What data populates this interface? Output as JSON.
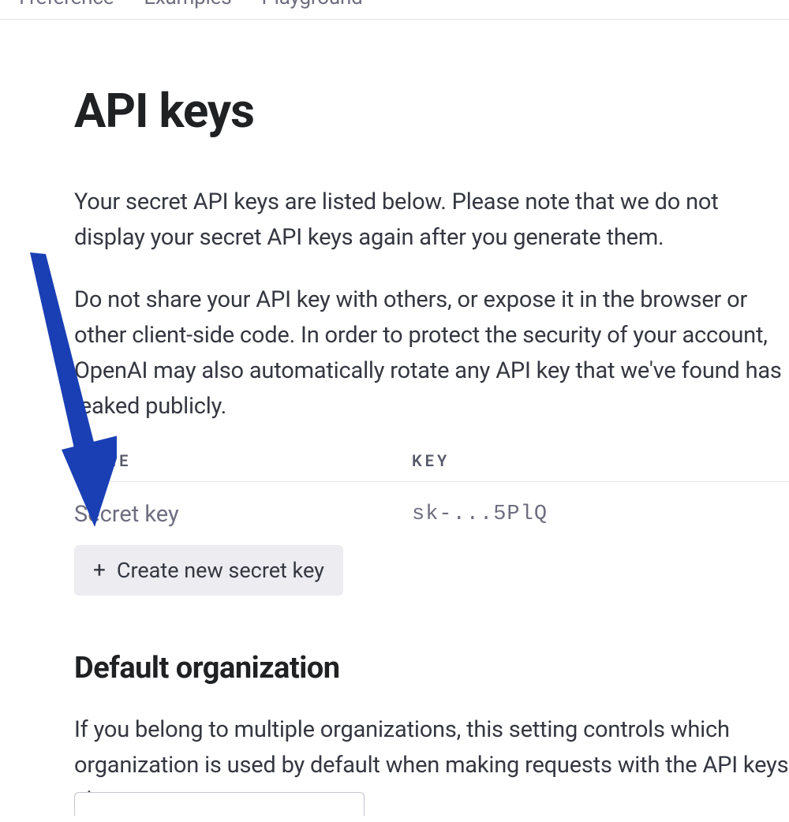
{
  "nav": {
    "items": [
      "I reference",
      "Examples",
      "Playground"
    ]
  },
  "page": {
    "title": "API keys",
    "intro_p1": "Your secret API keys are listed below. Please note that we do not display your secret API keys again after you generate them.",
    "intro_p2": "Do not share your API key with others, or expose it in the browser or other client-side code. In order to protect the security of your account, OpenAI may also automatically rotate any API key that we've found has leaked publicly."
  },
  "table": {
    "headers": {
      "name": "NAME",
      "key": "KEY"
    },
    "rows": [
      {
        "name": "Secret key",
        "key": "sk-...5PlQ"
      }
    ]
  },
  "create_button": {
    "label": "Create new secret key"
  },
  "org_section": {
    "title": "Default organization",
    "body": "If you belong to multiple organizations, this setting controls which organization is used by default when making requests with the API keys above."
  },
  "annotation": {
    "arrow_color": "#1a3fb5"
  }
}
